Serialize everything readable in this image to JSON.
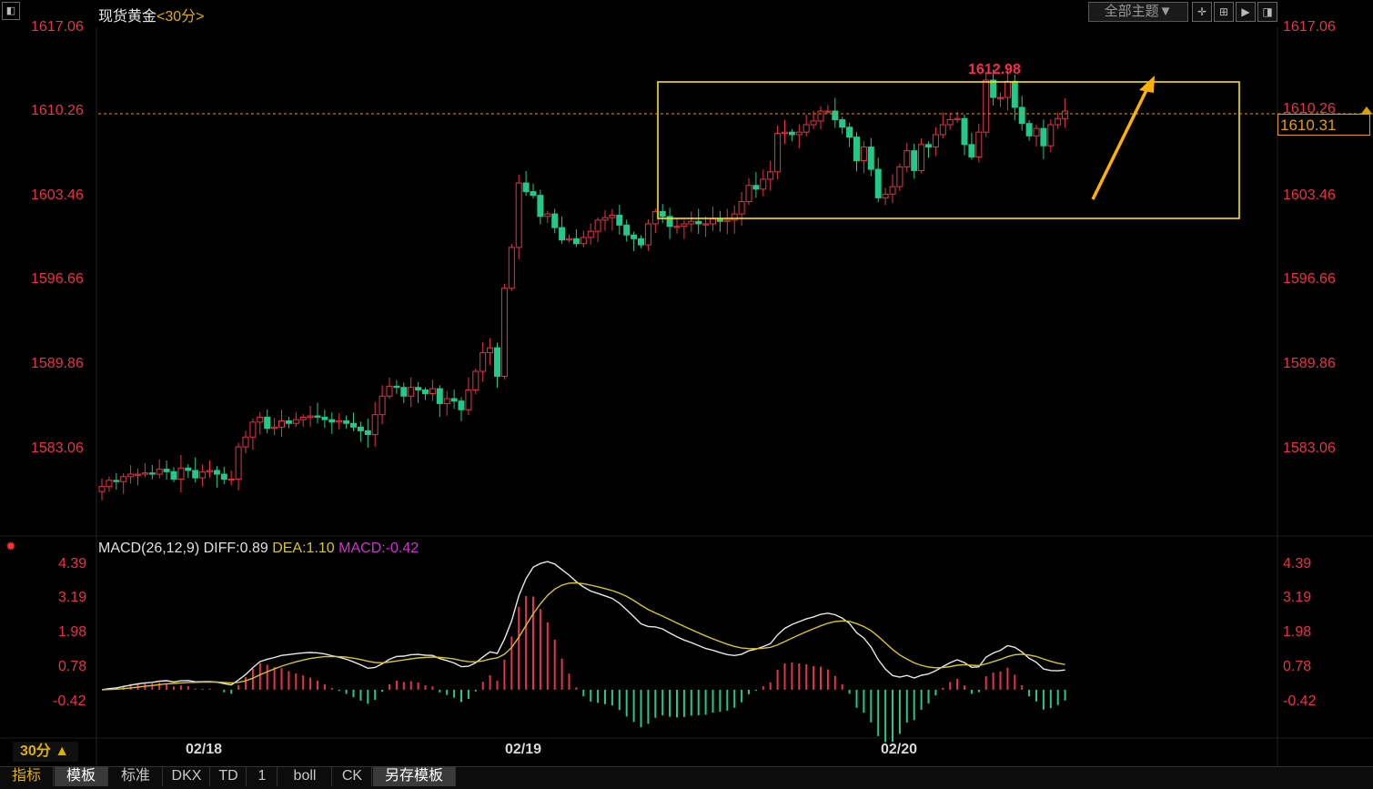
{
  "app": {
    "instrument": "现货黄金",
    "period_tag": "<30分>",
    "theme_button": "全部主题▼",
    "corner_icon": "collapse-icon"
  },
  "colors": {
    "up": "#e8324a",
    "down": "#23c98a",
    "box": "#ffe400",
    "arrow": "#ffb000",
    "last_line": "#e0a000",
    "diff": "#e8e8e8",
    "dea": "#d6c620"
  },
  "price_axis": {
    "ticks": [
      "1617.06",
      "1610.26",
      "1603.46",
      "1596.66",
      "1589.86",
      "1583.06"
    ],
    "last_price": "1610.31",
    "high_label": "1612.98"
  },
  "macd_header": {
    "name": "MACD(26,12,9)",
    "diff": "DIFF:0.89",
    "dea": "DEA:1.10",
    "macd": "MACD:-0.42"
  },
  "macd_axis": {
    "ticks": [
      "4.39",
      "3.19",
      "1.98",
      "0.78",
      "-0.42"
    ]
  },
  "x_axis": {
    "labels": [
      "02/18",
      "02/19",
      "02/20"
    ]
  },
  "bottom": {
    "period_button": "30分 ▲",
    "tabs": [
      "指标",
      "模板",
      "标准",
      "DKX",
      "TD",
      "1",
      "boll",
      "CK",
      "另存模板"
    ]
  },
  "chart_data": [
    {
      "type": "candlestick",
      "title": "现货黄金 30分",
      "x_labels": [
        "02/18",
        "02/19",
        "02/20"
      ],
      "ylim": [
        1578.0,
        1617.06
      ],
      "y_ticks": [
        1617.06,
        1610.26,
        1603.46,
        1596.66,
        1589.86,
        1583.06
      ],
      "last": 1610.31,
      "high_annotation": 1612.98,
      "range_box": {
        "low": 1601.5,
        "high": 1612.8
      },
      "closes": [
        1580.0,
        1580.5,
        1580.4,
        1580.8,
        1581.0,
        1581.0,
        1581.1,
        1581.0,
        1581.4,
        1581.2,
        1580.6,
        1581.5,
        1581.3,
        1580.7,
        1581.2,
        1581.3,
        1581.0,
        1580.6,
        1580.6,
        1583.2,
        1584.0,
        1585.2,
        1585.6,
        1584.7,
        1584.8,
        1585.3,
        1585.1,
        1585.4,
        1585.6,
        1585.7,
        1585.6,
        1585.4,
        1585.2,
        1585.3,
        1585.1,
        1584.8,
        1584.5,
        1584.2,
        1585.8,
        1587.3,
        1588.1,
        1588.0,
        1587.3,
        1588.0,
        1587.8,
        1587.5,
        1587.9,
        1586.7,
        1587.1,
        1586.9,
        1586.2,
        1587.8,
        1589.3,
        1590.8,
        1591.2,
        1588.9,
        1596.0,
        1599.3,
        1604.5,
        1603.8,
        1603.5,
        1601.8,
        1602.0,
        1600.9,
        1599.9,
        1600.0,
        1599.6,
        1600.1,
        1600.6,
        1601.5,
        1601.7,
        1601.9,
        1601.1,
        1600.3,
        1600.0,
        1599.5,
        1601.2,
        1602.2,
        1601.8,
        1601.0,
        1601.0,
        1601.2,
        1601.4,
        1601.2,
        1601.2,
        1601.6,
        1601.4,
        1601.5,
        1602.0,
        1603.0,
        1604.3,
        1604.0,
        1604.8,
        1605.4,
        1608.5,
        1608.6,
        1608.4,
        1608.6,
        1609.2,
        1609.5,
        1610.3,
        1610.3,
        1609.6,
        1609.0,
        1608.2,
        1606.3,
        1607.4,
        1605.6,
        1603.3,
        1603.6,
        1604.2,
        1605.8,
        1607.1,
        1605.5,
        1607.6,
        1607.4,
        1608.4,
        1609.2,
        1609.6,
        1609.7,
        1607.6,
        1606.6,
        1608.6,
        1612.8,
        1611.4,
        1611.4,
        1612.7,
        1610.6,
        1609.3,
        1608.3,
        1608.9,
        1607.5,
        1609.2,
        1609.7,
        1610.3
      ]
    },
    {
      "type": "macd",
      "params": "MACD(26,12,9)",
      "ylim": [
        -0.9,
        4.6
      ],
      "y_ticks": [
        4.39,
        3.19,
        1.98,
        0.78,
        -0.42
      ],
      "last": {
        "diff": 0.89,
        "dea": 1.1,
        "macd": -0.42
      }
    }
  ]
}
